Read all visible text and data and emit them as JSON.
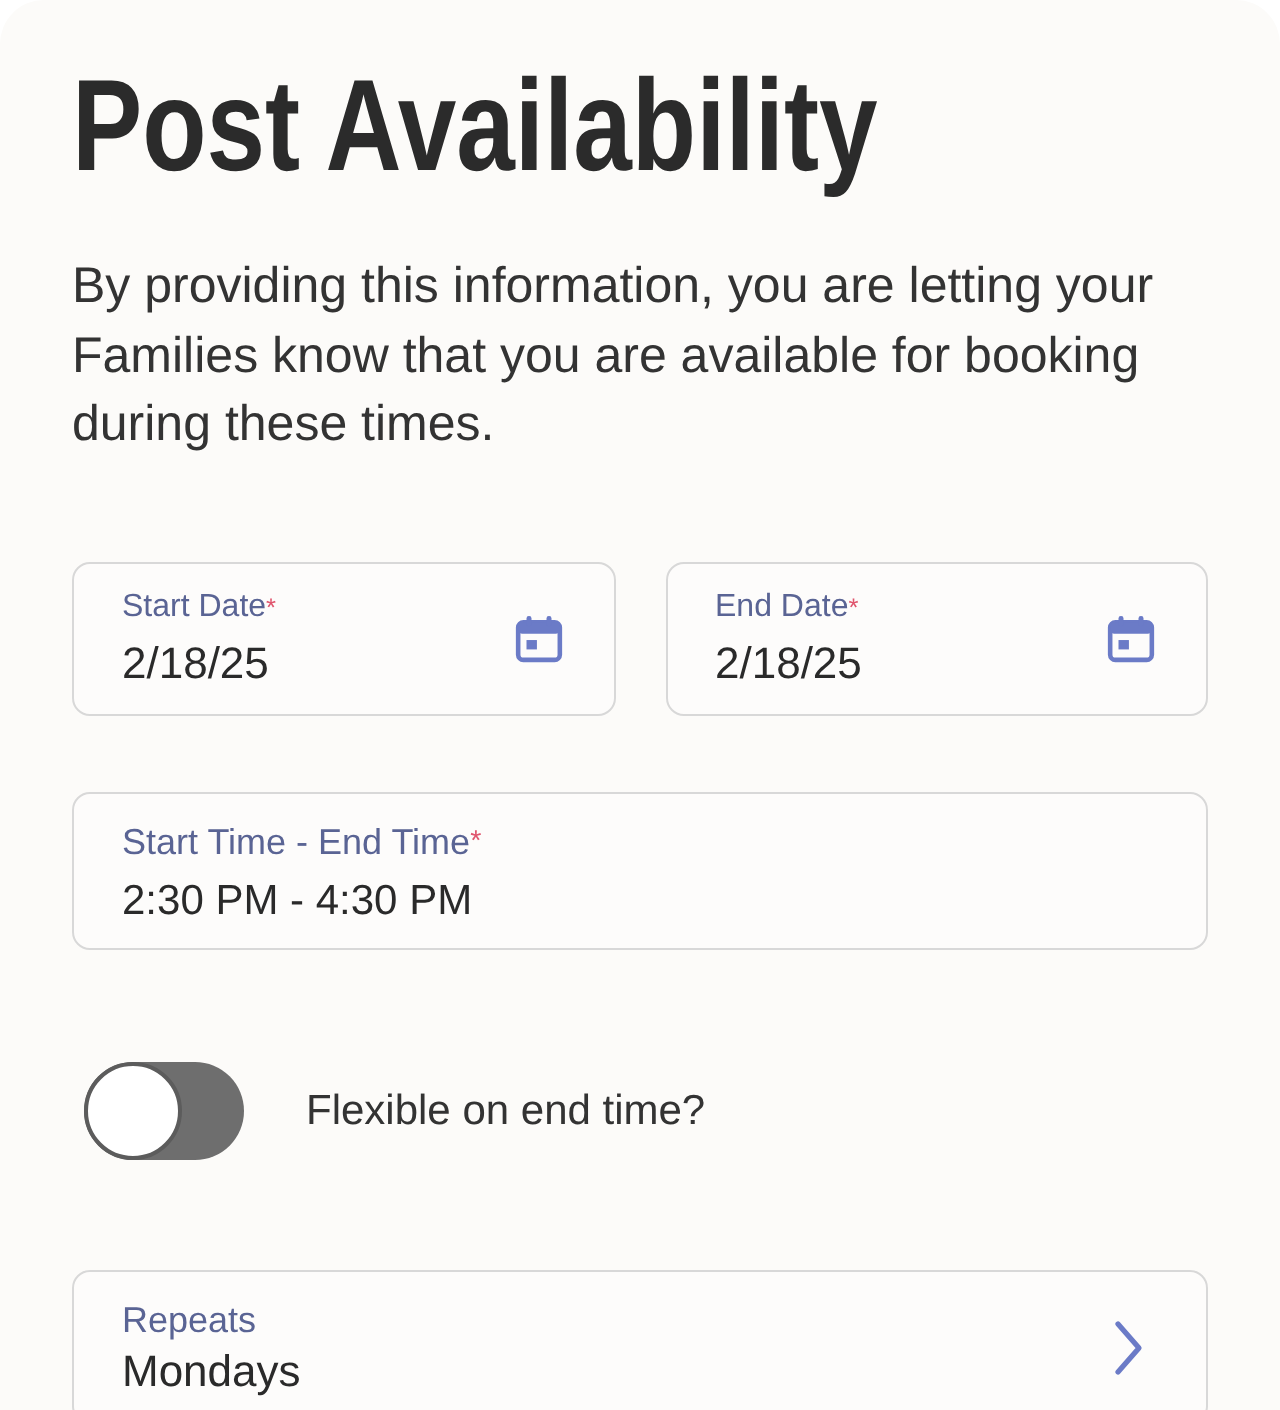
{
  "title": "Post Availability",
  "description": "By providing this information, you are letting your Families know that you are available for booking during these times.",
  "date_fields": [
    {
      "label": "Start Date",
      "required_mark": "*",
      "value": "2/18/25"
    },
    {
      "label": "End Date",
      "required_mark": "*",
      "value": "2/18/25"
    }
  ],
  "time_field": {
    "label": "Start Time - End Time",
    "required_mark": "*",
    "value": "2:30 PM - 4:30 PM"
  },
  "flexible_toggle": {
    "label": "Flexible on end time?",
    "on": false
  },
  "repeats": {
    "label": "Repeats",
    "value": "Mondays"
  }
}
